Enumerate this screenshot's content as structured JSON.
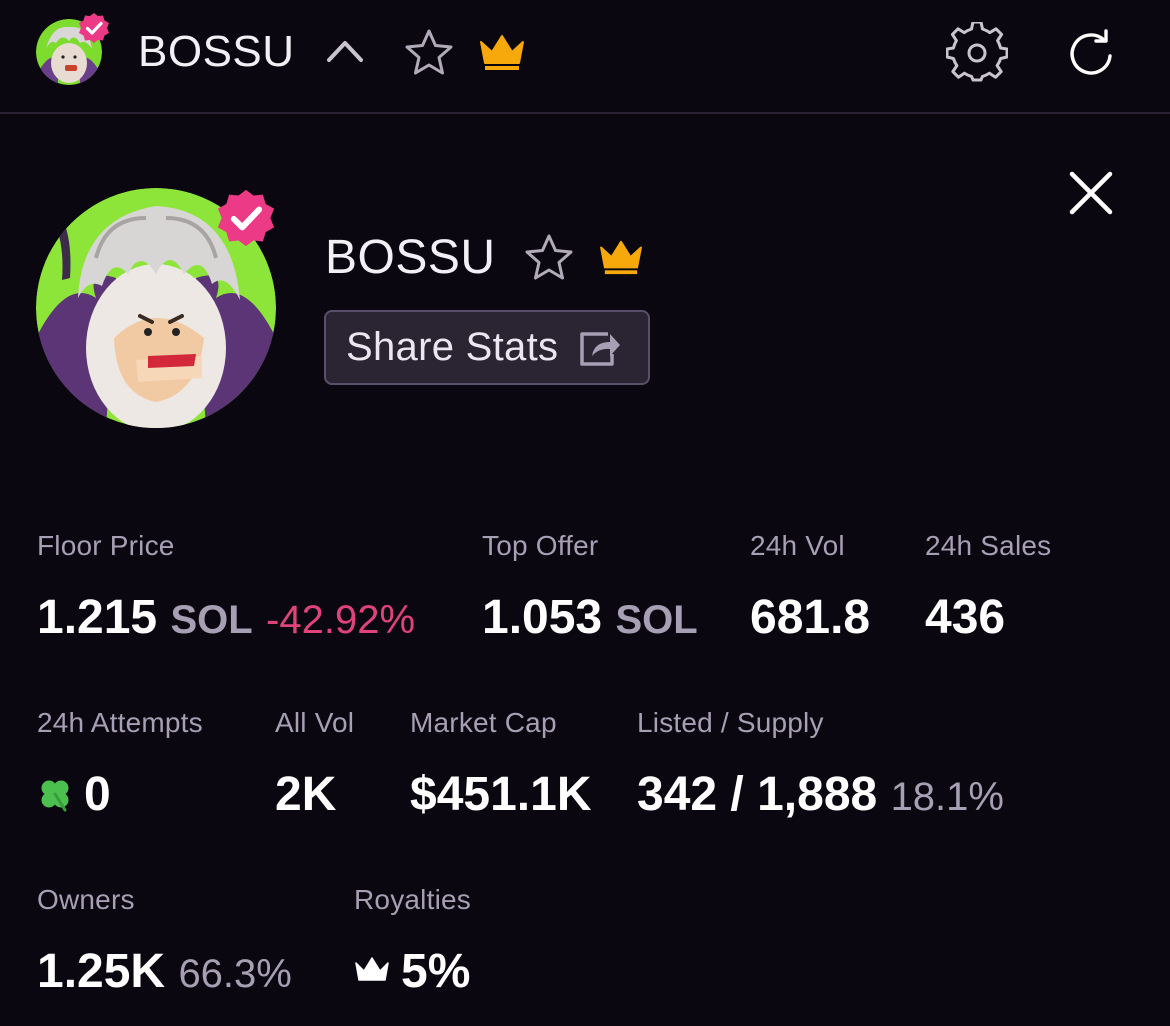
{
  "collection": {
    "name": "BOSSU"
  },
  "actions": {
    "share_label": "Share Stats"
  },
  "stats": {
    "floor_price": {
      "label": "Floor Price",
      "value": "1.215",
      "unit": "SOL",
      "change": "-42.92%"
    },
    "top_offer": {
      "label": "Top Offer",
      "value": "1.053",
      "unit": "SOL"
    },
    "vol_24h": {
      "label": "24h Vol",
      "value": "681.8"
    },
    "sales_24h": {
      "label": "24h Sales",
      "value": "436"
    },
    "attempts_24h": {
      "label": "24h Attempts",
      "value": "0"
    },
    "all_vol": {
      "label": "All Vol",
      "value": "2K"
    },
    "market_cap": {
      "label": "Market Cap",
      "value": "$451.1K"
    },
    "listed_supply": {
      "label": "Listed / Supply",
      "value": "342 / 1,888",
      "percent": "18.1%"
    },
    "owners": {
      "label": "Owners",
      "value": "1.25K",
      "percent": "66.3%"
    },
    "royalties": {
      "label": "Royalties",
      "value": "5%"
    }
  },
  "icons": {
    "verified": "verified-badge-icon",
    "chevron": "chevron-up-icon",
    "favorite": "star-icon",
    "premium": "crown-icon",
    "settings": "gear-icon",
    "refresh": "refresh-icon",
    "close": "close-icon",
    "share": "share-icon",
    "attempts": "clover-icon",
    "royalties": "crown-icon"
  },
  "colors": {
    "background": "#0a0710",
    "accent_pink": "#e0427a",
    "badge_pink": "#ec3a86",
    "crown_gold": "#f7a90c",
    "muted_text": "#a79fb4",
    "clover_green": "#4cc04f"
  }
}
